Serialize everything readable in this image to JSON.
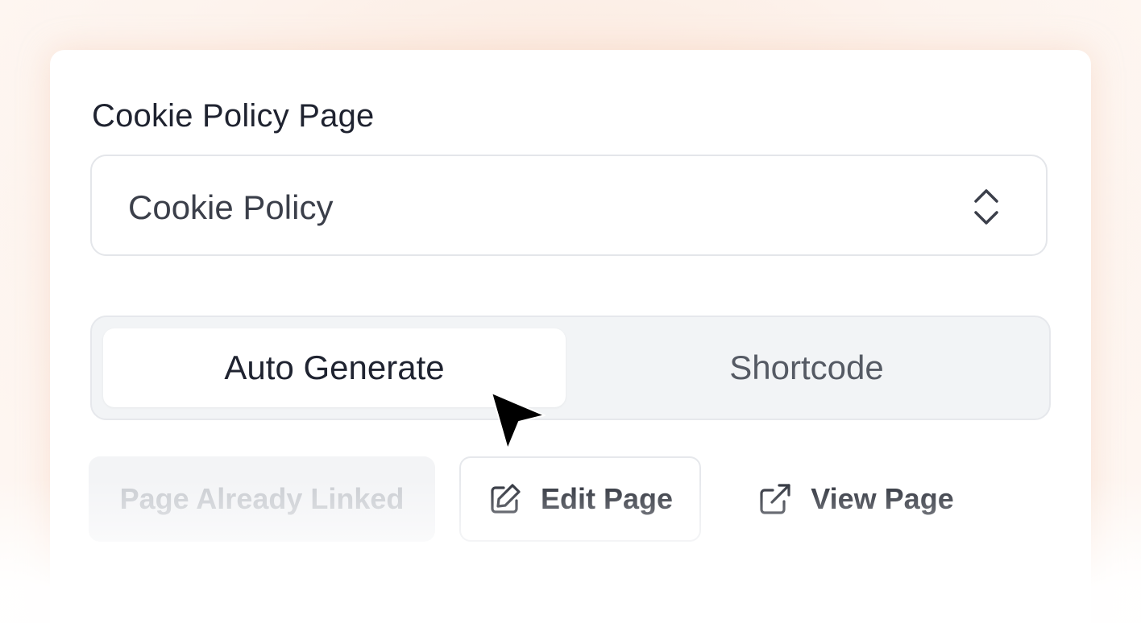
{
  "field": {
    "label": "Cookie Policy Page",
    "selected_value": "Cookie Policy"
  },
  "mode_toggle": {
    "options": [
      "Auto Generate",
      "Shortcode"
    ],
    "selected": "Auto Generate"
  },
  "actions": {
    "linked_label": "Page Already Linked",
    "edit_label": "Edit Page",
    "view_label": "View Page"
  },
  "icons": {
    "select": "chevrons-up-down-icon",
    "edit": "pencil-square-icon",
    "view": "external-link-icon",
    "cursor": "mouse-pointer-icon"
  },
  "colors": {
    "text_primary": "#1f2330",
    "toggle_bg": "#f2f4f6",
    "disabled_text": "#c9ccd1",
    "background_tint": "#fbe6d9"
  }
}
